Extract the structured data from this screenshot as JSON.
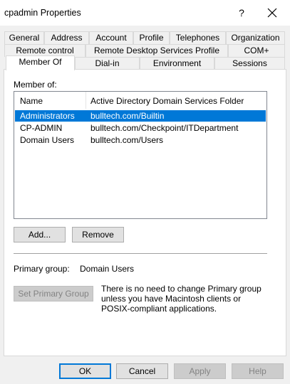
{
  "window": {
    "title": "cpadmin Properties",
    "help_glyph": "?",
    "close_glyph": "close"
  },
  "tabs": {
    "row1": [
      "General",
      "Address",
      "Account",
      "Profile",
      "Telephones",
      "Organization"
    ],
    "row2": [
      "Remote control",
      "Remote Desktop Services Profile",
      "COM+"
    ],
    "row3": [
      "Member Of",
      "Dial-in",
      "Environment",
      "Sessions"
    ],
    "active": "Member Of"
  },
  "member_of": {
    "label": "Member of:",
    "columns": [
      "Name",
      "Active Directory Domain Services Folder"
    ],
    "rows": [
      {
        "name": "Administrators",
        "folder": "bulltech.com/Builtin",
        "selected": true
      },
      {
        "name": "CP-ADMIN",
        "folder": "bulltech.com/Checkpoint/ITDepartment",
        "selected": false
      },
      {
        "name": "Domain Users",
        "folder": "bulltech.com/Users",
        "selected": false
      }
    ],
    "add_label": "Add...",
    "remove_label": "Remove"
  },
  "primary_group": {
    "label": "Primary group:",
    "value": "Domain Users",
    "set_button_label": "Set Primary Group",
    "note": "There is no need to change Primary group unless you have Macintosh clients or POSIX-compliant applications."
  },
  "footer": {
    "ok": "OK",
    "cancel": "Cancel",
    "apply": "Apply",
    "help": "Help"
  },
  "colors": {
    "selection": "#0078d7",
    "window_bg": "#f0f0f0"
  }
}
